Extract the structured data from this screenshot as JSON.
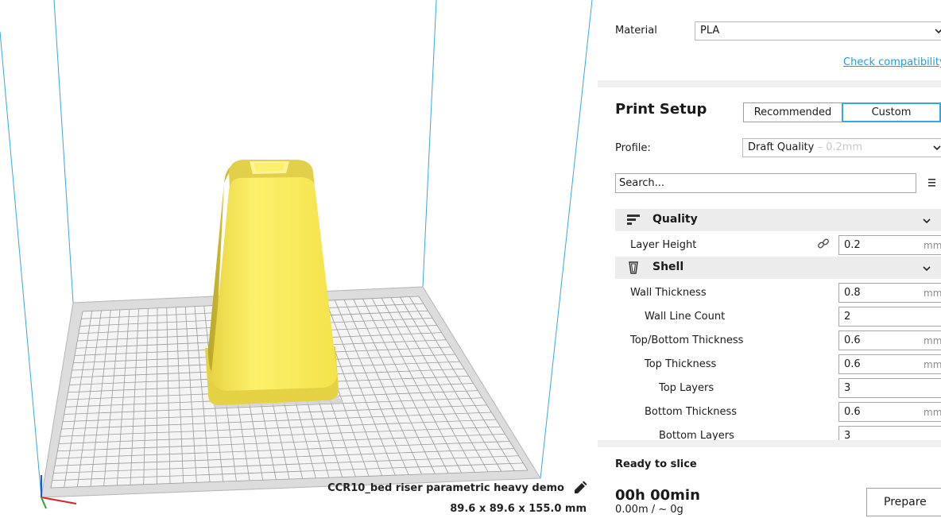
{
  "viewport": {
    "model_name": "CCR10_bed riser parametric heavy demo",
    "model_dimensions": "89.6 x 89.6 x 155.0 mm",
    "icons": [
      "pencil-icon"
    ]
  },
  "material": {
    "label": "Material",
    "value": "PLA",
    "check_link": "Check compatibility"
  },
  "print_setup": {
    "title": "Print Setup",
    "mode_recommended": "Recommended",
    "mode_custom": "Custom",
    "selected_mode": "Custom",
    "profile_label": "Profile:",
    "profile_value": "Draft Quality",
    "profile_sub": " – 0.2mm",
    "search_value": "Search...",
    "categories": [
      {
        "label": "Quality",
        "icon": "quality-icon"
      },
      {
        "label": "Shell",
        "icon": "shell-icon"
      }
    ],
    "settings": [
      {
        "label": "Layer Height",
        "value": "0.2",
        "unit": "mm"
      },
      {
        "label": "Wall Thickness",
        "value": "0.8",
        "unit": "mm"
      },
      {
        "label": "Wall Line Count",
        "value": "2",
        "unit": ""
      },
      {
        "label": "Top/Bottom Thickness",
        "value": "0.6",
        "unit": "mm"
      },
      {
        "label": "Top Thickness",
        "value": "0.6",
        "unit": "mm"
      },
      {
        "label": "Top Layers",
        "value": "3",
        "unit": ""
      },
      {
        "label": "Bottom Thickness",
        "value": "0.6",
        "unit": "mm"
      },
      {
        "label": "Bottom Layers",
        "value": "3",
        "unit": ""
      }
    ]
  },
  "slice": {
    "status": "Ready to slice",
    "time": "00h 00min",
    "estimate": "0.00m / ~ 0g",
    "prepare_label": "Prepare"
  },
  "colors": {
    "accent": "#1d9de2",
    "model": "#fdf06a",
    "build_volume_lines": "#3aa5e0",
    "sidebar_bg": "#f0f0f0"
  }
}
